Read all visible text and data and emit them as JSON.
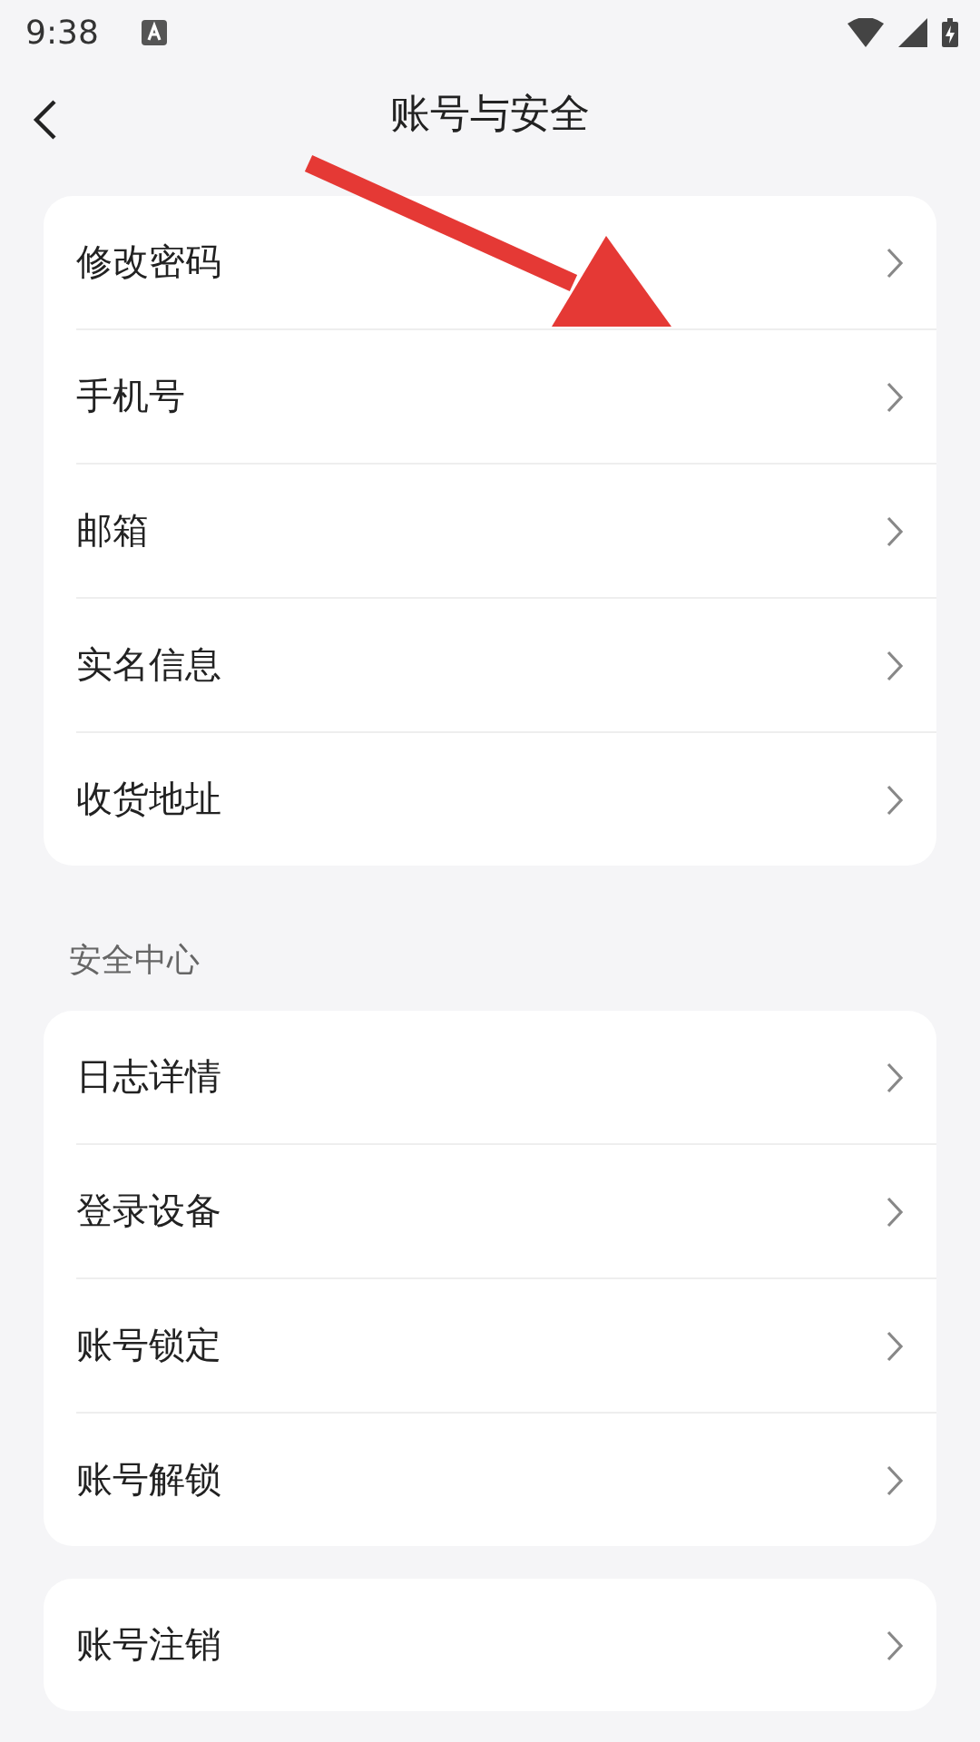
{
  "status_bar": {
    "time": "9:38"
  },
  "header": {
    "title": "账号与安全"
  },
  "groups": [
    {
      "items": [
        {
          "label": "修改密码"
        },
        {
          "label": "手机号"
        },
        {
          "label": "邮箱"
        },
        {
          "label": "实名信息"
        },
        {
          "label": "收货地址"
        }
      ]
    },
    {
      "title": "安全中心",
      "items": [
        {
          "label": "日志详情"
        },
        {
          "label": "登录设备"
        },
        {
          "label": "账号锁定"
        },
        {
          "label": "账号解锁"
        }
      ]
    },
    {
      "items": [
        {
          "label": "账号注销"
        }
      ]
    }
  ]
}
